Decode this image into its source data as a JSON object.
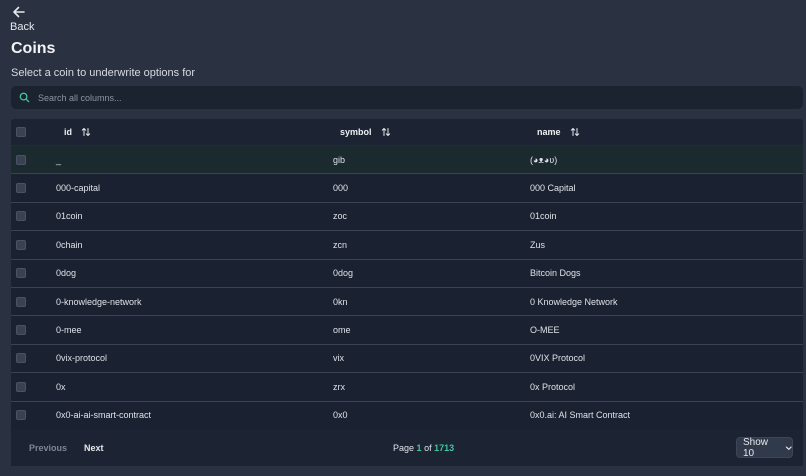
{
  "nav": {
    "back_label": "Back"
  },
  "page": {
    "title": "Coins",
    "subtitle": "Select a coin to underwrite options for"
  },
  "search": {
    "placeholder": "Search all columns..."
  },
  "table": {
    "columns": [
      "id",
      "symbol",
      "name"
    ],
    "rows": [
      {
        "id": "_",
        "symbol": "gib",
        "name": "(◕ᴥ◕ʋ)"
      },
      {
        "id": "000-capital",
        "symbol": "000",
        "name": "000 Capital"
      },
      {
        "id": "01coin",
        "symbol": "zoc",
        "name": "01coin"
      },
      {
        "id": "0chain",
        "symbol": "zcn",
        "name": "Zus"
      },
      {
        "id": "0dog",
        "symbol": "0dog",
        "name": "Bitcoin Dogs"
      },
      {
        "id": "0-knowledge-network",
        "symbol": "0kn",
        "name": "0 Knowledge Network"
      },
      {
        "id": "0-mee",
        "symbol": "ome",
        "name": "O-MEE"
      },
      {
        "id": "0vix-protocol",
        "symbol": "vix",
        "name": "0VIX Protocol"
      },
      {
        "id": "0x",
        "symbol": "zrx",
        "name": "0x Protocol"
      },
      {
        "id": "0x0-ai-ai-smart-contract",
        "symbol": "0x0",
        "name": "0x0.ai: AI Smart Contract"
      }
    ]
  },
  "pagination": {
    "previous_label": "Previous",
    "next_label": "Next",
    "page_prefix": "Page",
    "current_page": "1",
    "of_label": "of",
    "total_pages": "1713",
    "show_label": "Show 10"
  },
  "colors": {
    "accent": "#3fc6a0",
    "background": "#2a3241",
    "table": "#1a2130"
  }
}
